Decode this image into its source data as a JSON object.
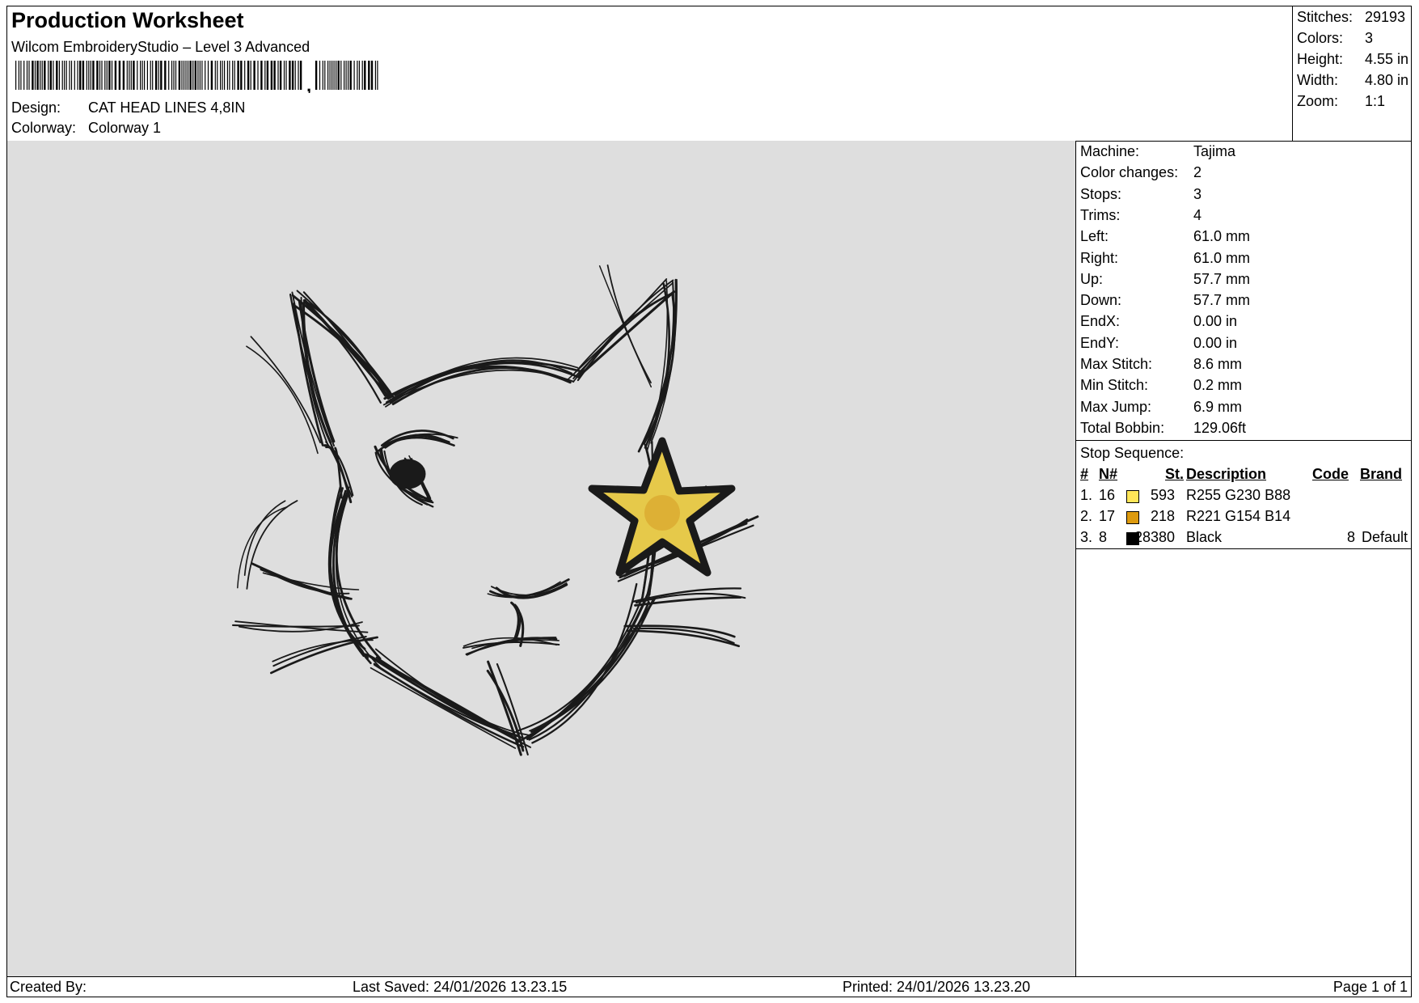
{
  "header": {
    "title": "Production Worksheet",
    "software": "Wilcom EmbroideryStudio – Level 3 Advanced",
    "design_label": "Design:",
    "design_value": "CAT HEAD LINES 4,8IN",
    "colorway_label": "Colorway:",
    "colorway_value": "Colorway 1"
  },
  "summary": {
    "stitches_label": "Stitches:",
    "stitches": "29193",
    "colors_label": "Colors:",
    "colors": "3",
    "height_label": "Height:",
    "height": "4.55 in",
    "width_label": "Width:",
    "width": "4.80 in",
    "zoom_label": "Zoom:",
    "zoom": "1:1"
  },
  "machine_info": [
    {
      "label": "Machine:",
      "value": "Tajima"
    },
    {
      "label": "Color changes:",
      "value": "2"
    },
    {
      "label": "Stops:",
      "value": "3"
    },
    {
      "label": "Trims:",
      "value": "4"
    },
    {
      "label": "Left:",
      "value": "61.0 mm"
    },
    {
      "label": "Right:",
      "value": "61.0 mm"
    },
    {
      "label": "Up:",
      "value": "57.7 mm"
    },
    {
      "label": "Down:",
      "value": "57.7 mm"
    },
    {
      "label": "EndX:",
      "value": "0.00 in"
    },
    {
      "label": "EndY:",
      "value": "0.00 in"
    },
    {
      "label": "Max Stitch:",
      "value": "8.6 mm"
    },
    {
      "label": "Min Stitch:",
      "value": "0.2 mm"
    },
    {
      "label": "Max Jump:",
      "value": "6.9 mm"
    },
    {
      "label": "Total Bobbin:",
      "value": "129.06ft"
    }
  ],
  "stop_sequence": {
    "title": "Stop Sequence:",
    "headers": {
      "num": "#",
      "n": "N#",
      "st": "St.",
      "description": "Description",
      "code": "Code",
      "brand": "Brand"
    },
    "rows": [
      {
        "num": "1.",
        "n": "16",
        "color": "#ffe658",
        "st": "593",
        "description": "R255 G230 B88",
        "code": "",
        "brand": ""
      },
      {
        "num": "2.",
        "n": "17",
        "color": "#dd9a0e",
        "st": "218",
        "description": "R221 G154 B14",
        "code": "",
        "brand": ""
      },
      {
        "num": "3.",
        "n": "8",
        "color": "#000000",
        "st": "28380",
        "description": "Black",
        "code": "8",
        "brand": "Default"
      }
    ]
  },
  "footer": {
    "created_by": "Created By:",
    "last_saved": "Last Saved: 24/01/2026 13.23.15",
    "printed": "Printed: 24/01/2026 13.23.20",
    "page": "Page 1 of 1"
  },
  "colors": {
    "canvas_bg": "#dedede",
    "thread_black": "#1a1a1a",
    "star_fill": "#e6c94a",
    "star_center": "#d9a52c"
  }
}
